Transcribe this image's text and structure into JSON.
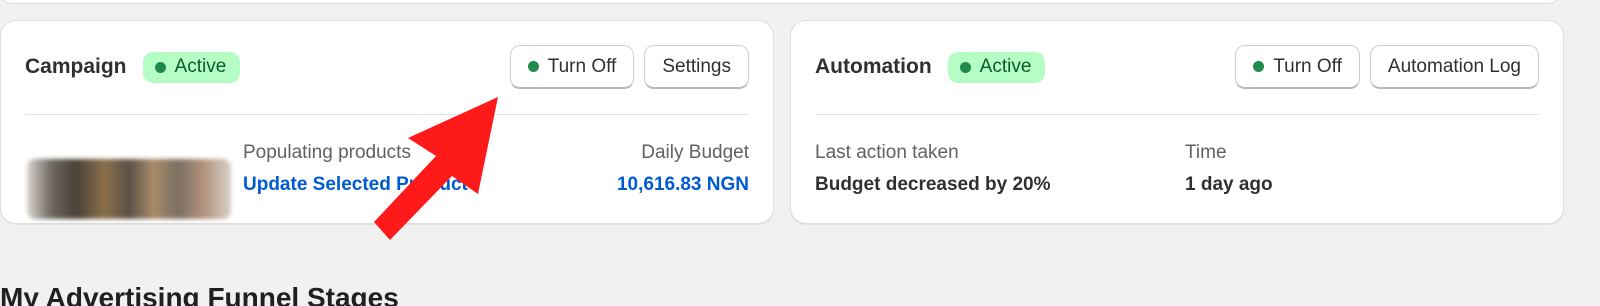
{
  "campaign": {
    "title": "Campaign",
    "status": "Active",
    "turn_off_label": "Turn Off",
    "settings_label": "Settings",
    "populating_label": "Populating products",
    "update_link": "Update Selected Product",
    "budget_label": "Daily Budget",
    "budget_value": "10,616.83 NGN"
  },
  "automation": {
    "title": "Automation",
    "status": "Active",
    "turn_off_label": "Turn Off",
    "log_label": "Automation Log",
    "last_action_label": "Last action taken",
    "last_action_value": "Budget decreased by 20%",
    "time_label": "Time",
    "time_value": "1 day ago"
  },
  "section": {
    "heading": "My Advertising Funnel Stages"
  },
  "colors": {
    "active_badge_bg": "#b4fec6",
    "active_dot": "#1f8a4c",
    "link": "#005bd3",
    "annotation_arrow": "#ff1a1a"
  },
  "icons": {
    "annotation": "red-arrow-icon",
    "status": "status-dot-icon"
  }
}
